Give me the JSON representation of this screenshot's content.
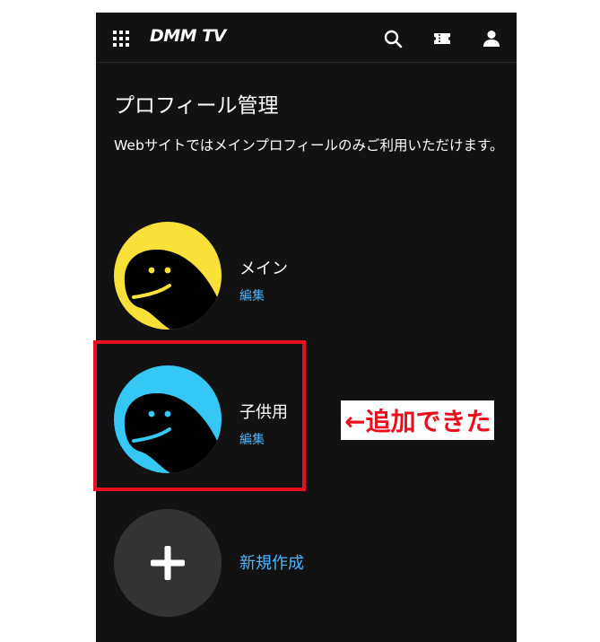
{
  "header": {
    "logo_text": "DMM TV",
    "icons": [
      "grid-menu-icon",
      "search-icon",
      "ticket-icon",
      "user-icon"
    ]
  },
  "page": {
    "title": "プロフィール管理",
    "description": "Webサイトではメインプロフィールのみご利用いただけます。"
  },
  "profiles": [
    {
      "name": "メイン",
      "edit_label": "編集",
      "avatar_color": "#f9e13a"
    },
    {
      "name": "子供用",
      "edit_label": "編集",
      "avatar_color": "#35c8f5"
    }
  ],
  "new_profile": {
    "label": "新規作成"
  },
  "annotation": {
    "text": "←追加できた",
    "color": "#e8101e"
  },
  "colors": {
    "background": "#121212",
    "link": "#4db5ff",
    "new_button": "#333333"
  }
}
